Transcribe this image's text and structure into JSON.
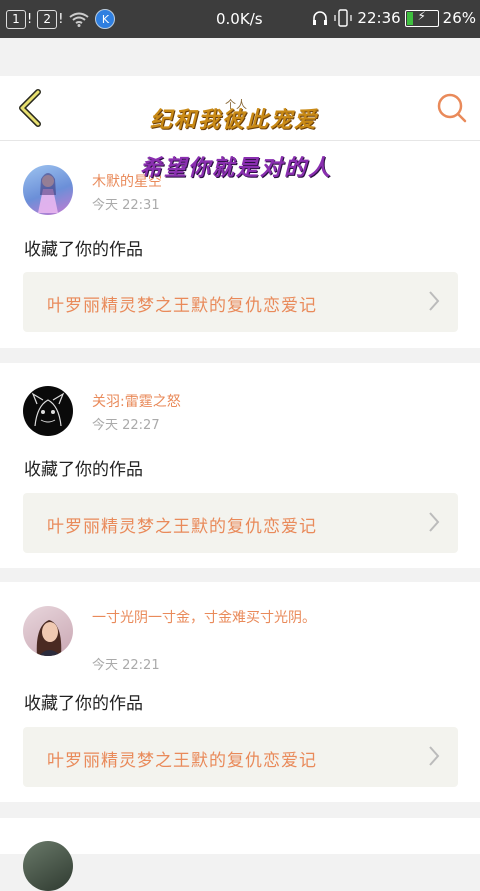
{
  "status_bar": {
    "sim1": "1",
    "sim2": "2",
    "k_badge": "K",
    "net_speed": "0.0K/s",
    "time": "22:36",
    "battery": "26%",
    "battery_level": 0.26
  },
  "header": {
    "subtitle": "个人",
    "banner_line1": "纪和我彼此宠爱",
    "banner_line2": "希望你就是对的人"
  },
  "feed": [
    {
      "username": "木默的星空",
      "time": "今天 22:31",
      "action": "收藏了你的作品",
      "work_title": "叶罗丽精灵梦之王默的复仇恋爱记"
    },
    {
      "username": "关羽:雷霆之怒",
      "time": "今天 22:27",
      "action": "收藏了你的作品",
      "work_title": "叶罗丽精灵梦之王默的复仇恋爱记"
    },
    {
      "username": "一寸光阴一寸金，寸金难买寸光阴。",
      "time": "今天 22:21",
      "action": "收藏了你的作品",
      "work_title": "叶罗丽精灵梦之王默的复仇恋爱记"
    }
  ],
  "colors": {
    "accent": "#e98a5a",
    "status_bar": "#3d3d3d",
    "work_box": "#f3f3ee"
  }
}
